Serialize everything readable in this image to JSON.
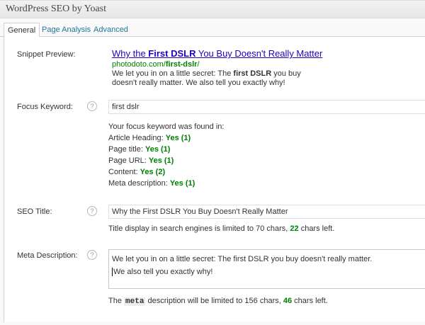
{
  "metabox": {
    "title": "WordPress SEO by Yoast"
  },
  "tabs": [
    {
      "label": "General"
    },
    {
      "label": "Page Analysis"
    },
    {
      "label": "Advanced"
    }
  ],
  "snippet": {
    "label": "Snippet Preview:",
    "title_pre": "Why the ",
    "title_kw": "First DSLR",
    "title_post": " You Buy Doesn't Really Matter",
    "url_pre": "photodoto.com/",
    "url_kw": "first-dslr",
    "url_post": "/",
    "desc_pre": "We let you in on a little secret: The ",
    "desc_kw": "first DSLR",
    "desc_post": " you buy doesn't really matter. We also tell you exactly why!"
  },
  "focus": {
    "label": "Focus Keyword:",
    "value": "first dslr",
    "found_intro": "Your focus keyword was found in:",
    "items": [
      {
        "label": "Article Heading:",
        "result": "Yes (1)"
      },
      {
        "label": "Page title:",
        "result": "Yes (1)"
      },
      {
        "label": "Page URL:",
        "result": "Yes (1)"
      },
      {
        "label": "Content:",
        "result": "Yes (2)"
      },
      {
        "label": "Meta description:",
        "result": "Yes (1)"
      }
    ]
  },
  "seo_title": {
    "label": "SEO Title:",
    "value": "Why the First DSLR You Buy Doesn't Really Matter",
    "note_pre": "Title display in search engines is limited to 70 chars, ",
    "note_count": "22",
    "note_post": " chars left."
  },
  "meta_desc": {
    "label": "Meta Description:",
    "line1": "We let you in on a little secret: The first DSLR you buy doesn't really matter.",
    "line2": "We also tell you exactly why!",
    "note_pre": "The ",
    "note_code": "meta",
    "note_mid": " description will be limited to 156 chars, ",
    "note_count": "46",
    "note_post": " chars left."
  },
  "help_glyph": "?"
}
